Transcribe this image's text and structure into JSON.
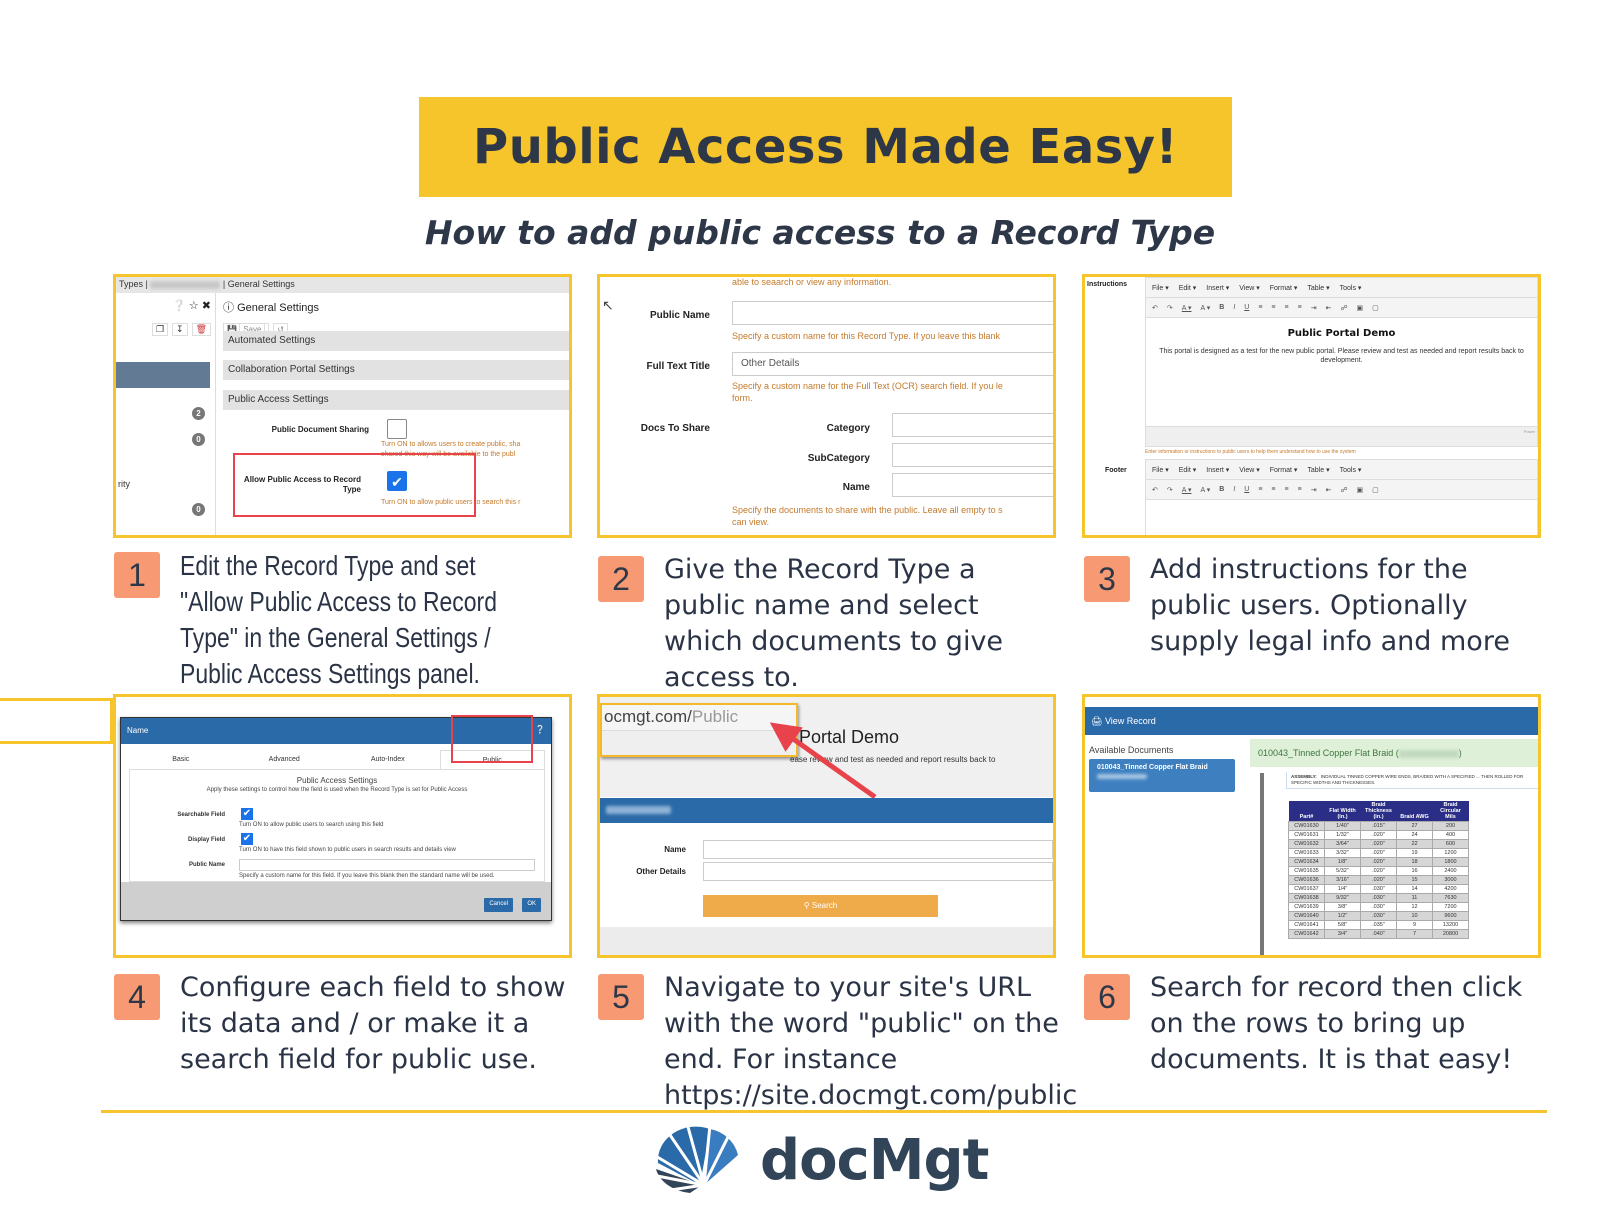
{
  "header": {
    "title": "Public Access Made Easy!",
    "subtitle": "How to add public access to a Record Type"
  },
  "steps": [
    {
      "number": "1",
      "text": "Edit the Record Type and set \"Allow Public Access to Record Type\" in the General Settings / Public Access Settings panel."
    },
    {
      "number": "2",
      "text": "Give the Record Type a public name and select which documents to give access to."
    },
    {
      "number": "3",
      "text": "Add instructions for the public users. Optionally supply legal info and more"
    },
    {
      "number": "4",
      "text": "Configure each field to show its data and / or make it a search field for public use."
    },
    {
      "number": "5",
      "text": "Navigate to your site's URL with the word \"public\" on the end. For instance https://site.docmgt.com/public"
    },
    {
      "number": "6",
      "text": "Search for record then click on the rows to bring up documents. It is that easy!"
    }
  ],
  "panel1": {
    "breadcrumb_left": "Types |",
    "breadcrumb_right": "| General Settings",
    "section_title": "General Settings",
    "save_label": "Save",
    "badges": [
      "2",
      "0",
      "0"
    ],
    "partial_label": "rity",
    "accordions": [
      "Automated Settings",
      "Collaboration Portal Settings",
      "Public Access Settings"
    ],
    "public_doc_sharing_label": "Public Document Sharing",
    "public_doc_sharing_checked": false,
    "public_doc_sharing_hint": "Turn ON to allows users to create public, sha",
    "public_doc_sharing_hint2": "shared this way will be available to the publ",
    "allow_public_label": "Allow Public Access to Record Type",
    "allow_public_checked": true,
    "allow_public_hint": "Turn ON to allow public users to search this r"
  },
  "panel2": {
    "top_hint": "able to seaarch or view any information.",
    "public_name_label": "Public Name",
    "public_name_value": "",
    "public_name_hint": "Specify a custom name for this Record Type. If you leave this blank",
    "full_text_label": "Full Text Title",
    "full_text_value": "Other Details",
    "full_text_hint": "Specify a custom name for the Full Text (OCR) search field. If you le",
    "full_text_hint2": "form.",
    "docs_label": "Docs To Share",
    "category_label": "Category",
    "subcategory_label": "SubCategory",
    "name_label": "Name",
    "docs_hint": "Specify the documents to share with the public. Leave all empty to s",
    "docs_hint2": "can view."
  },
  "panel3": {
    "instructions_label": "Instructions",
    "footer_label": "Footer",
    "menu": [
      "File ▾",
      "Edit ▾",
      "Insert ▾",
      "View ▾",
      "Format ▾",
      "Table ▾",
      "Tools ▾"
    ],
    "toolbar": [
      "↶",
      "↷",
      "A ▾",
      "A ▾",
      "B",
      "I",
      "U",
      "≡",
      "≡",
      "≡",
      "≡",
      "⇥",
      "⇤",
      "☍",
      "▣",
      "▢"
    ],
    "editor_heading": "Public Portal Demo",
    "editor_body": "This portal is designed as a test for the new public portal. Please review and test as needed and report results back to development.",
    "instructions_hint": "Enter information or instructions to public users to help them understand how to use the system",
    "powered_label": "Power"
  },
  "panel4": {
    "dialog_title": "Name",
    "tabs": [
      "Basic",
      "Advanced",
      "Auto-Index",
      "Public"
    ],
    "active_tab": "Public",
    "section_title": "Public Access Settings",
    "section_desc": "Apply these settings to control how the field is used when the Record Type is set for Public Access",
    "searchable_label": "Searchable Field",
    "searchable_checked": true,
    "searchable_hint": "Turn ON to allow public users to search using this field",
    "display_label": "Display Field",
    "display_checked": true,
    "display_hint": "Turn ON to have this field shown to public users in search results and details view",
    "public_name_label": "Public Name",
    "public_name_value": "",
    "public_name_hint": "Specify a custom name for this field. If you leave this blank then the standard name will be used.",
    "cancel_label": "Cancel",
    "ok_label": "OK"
  },
  "panel5": {
    "url_host": "ocmgt.com/",
    "url_path": "Public",
    "portal_title": "Portal Demo",
    "portal_sub": "ease review and test as needed and report results back to",
    "name_label": "Name",
    "other_label": "Other Details",
    "search_label": "Search"
  },
  "panel6": {
    "header": "View Record",
    "available_label": "Available Documents",
    "doc_button": "010043_Tinned Copper Flat Braid",
    "viewer_title": "010043_Tinned Copper Flat Braid (",
    "viewer_title_end": ")",
    "assembly_label": "ASSEMBLY:",
    "assembly_text": "INDIVIDUAL TINNED COPPER WIRE ENDS, BRAIDED WITH A SPECIFIED ... THEN ROLLED FOR SPECIFIC WIDTHS AND THICKNESSES.",
    "columns": [
      "Part#",
      "Flat Width (in.)",
      "Braid Thickness (in.)",
      "Braid AWG",
      "Braid Circular Mils"
    ],
    "rows": [
      [
        "CW01630",
        "1/40\"",
        ".015\"",
        "27",
        "200"
      ],
      [
        "CW01631",
        "1/32\"",
        ".020\"",
        "24",
        "400"
      ],
      [
        "CW01632",
        "3/64\"",
        ".020\"",
        "22",
        "600"
      ],
      [
        "CW01633",
        "3/32\"",
        ".020\"",
        "19",
        "1200"
      ],
      [
        "CW01634",
        "1/8\"",
        ".020\"",
        "18",
        "1800"
      ],
      [
        "CW01635",
        "5/32\"",
        ".020\"",
        "16",
        "2400"
      ],
      [
        "CW01636",
        "3/16\"",
        ".020\"",
        "15",
        "3000"
      ],
      [
        "CW01637",
        "1/4\"",
        ".030\"",
        "14",
        "4200"
      ],
      [
        "CW01638",
        "9/32\"",
        ".030\"",
        "11",
        "7630"
      ],
      [
        "CW01639",
        "3/8\"",
        ".030\"",
        "12",
        "7200"
      ],
      [
        "CW01640",
        "1/2\"",
        ".030\"",
        "10",
        "9600"
      ],
      [
        "CW01641",
        "5/8\"",
        ".035\"",
        "9",
        "13200"
      ],
      [
        "CW01642",
        "3/4\"",
        ".040\"",
        "7",
        "20800"
      ]
    ]
  },
  "footer": {
    "brand": "docMgt"
  },
  "colors": {
    "accent_yellow": "#f6c52b",
    "step_badge": "#f79a73",
    "text_dark": "#2d3748",
    "highlight_red": "#e8434a",
    "ui_blue": "#2b6aa8"
  }
}
